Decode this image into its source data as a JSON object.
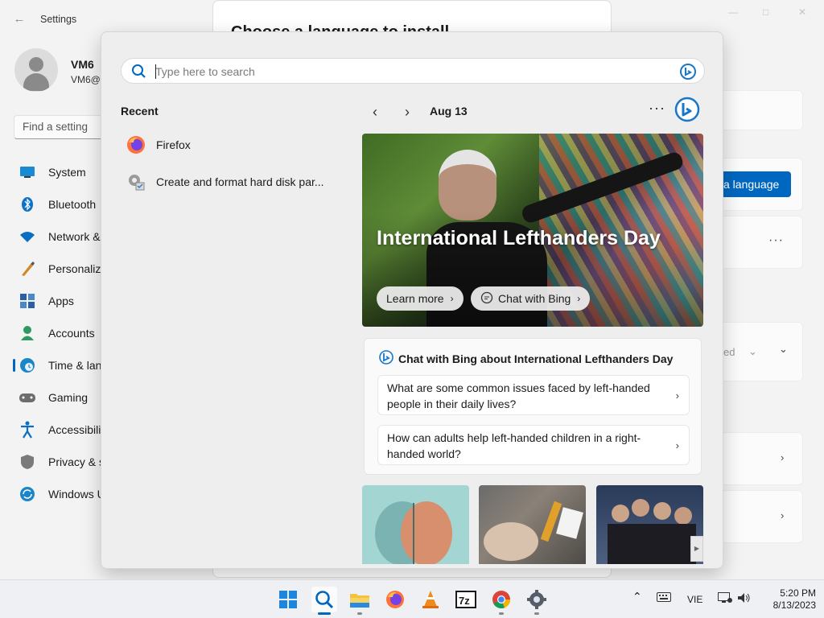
{
  "settings": {
    "title": "Settings",
    "profile_name": "VM6",
    "profile_email": "VM6@",
    "find_placeholder": "Find a setting",
    "nav": [
      {
        "label": "System",
        "icon": "monitor-icon"
      },
      {
        "label": "Bluetooth",
        "icon": "bluetooth-icon"
      },
      {
        "label": "Network &",
        "icon": "wifi-icon"
      },
      {
        "label": "Personaliza",
        "icon": "brush-icon"
      },
      {
        "label": "Apps",
        "icon": "apps-icon"
      },
      {
        "label": "Accounts",
        "icon": "person-icon"
      },
      {
        "label": "Time & lan",
        "icon": "globe-clock-icon"
      },
      {
        "label": "Gaming",
        "icon": "gamepad-icon"
      },
      {
        "label": "Accessibili",
        "icon": "accessibility-icon"
      },
      {
        "label": "Privacy & s",
        "icon": "shield-icon"
      },
      {
        "label": "Windows U",
        "icon": "update-icon"
      }
    ],
    "add_language_label": "a language",
    "dropdown_fragment": "ed"
  },
  "dialog": {
    "title": "Choose a language to install"
  },
  "flyout": {
    "search": {
      "placeholder": "Type here to search"
    },
    "recent": {
      "heading": "Recent",
      "items": [
        {
          "label": "Firefox",
          "icon": "firefox-icon"
        },
        {
          "label": "Create and format hard disk par...",
          "icon": "settings-gear-icon"
        }
      ]
    },
    "header": {
      "date": "Aug 13",
      "more": "···"
    },
    "hero": {
      "title": "International Lefthanders Day",
      "learn_more": "Learn more",
      "chat_with_bing": "Chat with Bing"
    },
    "chat": {
      "title": "Chat with Bing about International Lefthanders Day",
      "questions": [
        "What are some common issues faced by left-handed people in their daily lives?",
        "How can adults help left-handed children in a right-handed world?"
      ]
    }
  },
  "taskbar": {
    "apps": [
      "start-icon",
      "search-icon",
      "file-explorer-icon",
      "firefox-icon",
      "vlc-icon",
      "7zip-icon",
      "chrome-icon",
      "settings-icon"
    ],
    "tray": {
      "language": "VIE"
    },
    "clock": {
      "time": "5:20 PM",
      "date": "8/13/2023"
    }
  },
  "colors": {
    "accent": "#0067c0",
    "bing": "#1877c9"
  }
}
